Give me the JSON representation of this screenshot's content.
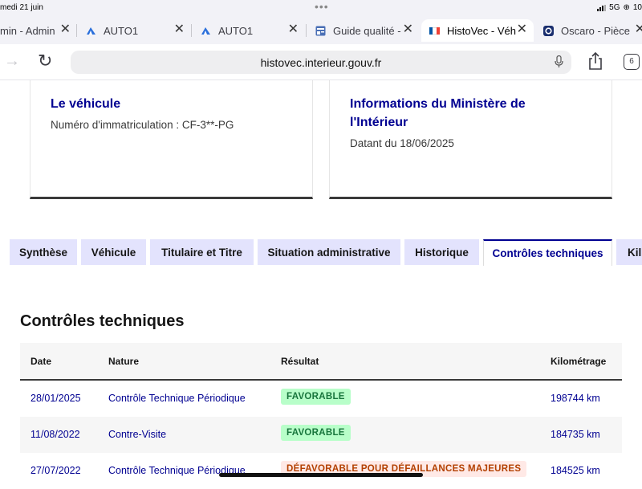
{
  "status_bar": {
    "date": "medi 21 juin",
    "network": "5G",
    "battery": "10"
  },
  "browser_tabs": [
    {
      "label": "min - Admin",
      "favicon": "generic-icon"
    },
    {
      "label": "AUTO1",
      "favicon": "auto1-icon"
    },
    {
      "label": "AUTO1",
      "favicon": "auto1-icon"
    },
    {
      "label": "Guide qualité -",
      "favicon": "doc-icon"
    },
    {
      "label": "HistoVec - Véh",
      "favicon": "french-flag-icon",
      "active": true
    },
    {
      "label": "Oscaro - Pièce",
      "favicon": "oscaro-icon"
    }
  ],
  "address_bar": {
    "url": "histovec.interieur.gouv.fr",
    "tab_count": "6"
  },
  "vehicle_card": {
    "title": "Le véhicule",
    "plate_text": "Numéro d'immatriculation : CF-3**-PG"
  },
  "ministry_card": {
    "title_line1": "Informations du Ministère de",
    "title_line2": "l'Intérieur",
    "date_text": "Datant du 18/06/2025"
  },
  "section_tabs": [
    {
      "label": "Synthèse"
    },
    {
      "label": "Véhicule"
    },
    {
      "label": "Titulaire et Titre"
    },
    {
      "label": "Situation administrative"
    },
    {
      "label": "Historique"
    },
    {
      "label": "Contrôles techniques",
      "active": true
    },
    {
      "label": "Kil"
    }
  ],
  "content": {
    "title": "Contrôles techniques",
    "table": {
      "headers": {
        "date": "Date",
        "nature": "Nature",
        "result": "Résultat",
        "km": "Kilométrage"
      },
      "rows": [
        {
          "date": "28/01/2025",
          "nature": "Contrôle Technique Périodique",
          "result": "FAVORABLE",
          "result_status": "ok",
          "km": "198744 km"
        },
        {
          "date": "11/08/2022",
          "nature": "Contre-Visite",
          "result": "FAVORABLE",
          "result_status": "ok",
          "km": "184735 km"
        },
        {
          "date": "27/07/2022",
          "nature": "Contrôle Technique Périodique",
          "result": "DÉFAVORABLE POUR DÉFAILLANCES MAJEURES",
          "result_status": "ko",
          "km": "184525 km"
        }
      ]
    }
  },
  "colors": {
    "accent": "#000091",
    "tab_bg": "#e3e3fd",
    "ok_bg": "#b8fec9",
    "ok_text": "#18753c",
    "ko_bg": "#ffe9e6",
    "ko_text": "#b34000"
  }
}
